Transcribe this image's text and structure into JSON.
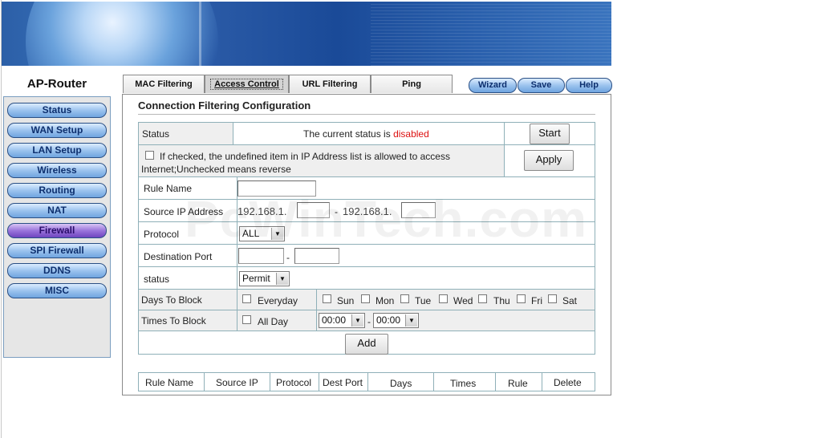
{
  "brand": "AP-Router",
  "nav": [
    {
      "label": "Status"
    },
    {
      "label": "WAN Setup"
    },
    {
      "label": "LAN Setup"
    },
    {
      "label": "Wireless"
    },
    {
      "label": "Routing"
    },
    {
      "label": "NAT"
    },
    {
      "label": "Firewall",
      "active": true
    },
    {
      "label": "SPI Firewall"
    },
    {
      "label": "DDNS"
    },
    {
      "label": "MISC"
    }
  ],
  "tabs": [
    "MAC Filtering",
    "Access Control",
    "URL Filtering",
    "Ping"
  ],
  "top_buttons": {
    "wizard": "Wizard",
    "save": "Save",
    "help": "Help"
  },
  "panel": {
    "title": "Connection Filtering Configuration",
    "status_label": "Status",
    "status_text": "The current status is",
    "status_value": "disabled",
    "start_button": "Start",
    "checkbox_text": "If checked, the undefined item in IP Address list is allowed to access Internet;Unchecked means reverse",
    "apply_button": "Apply",
    "rule_name_label": "Rule Name",
    "rule_name_value": "",
    "source_ip_label": "Source IP Address",
    "source_ip_prefix_start": "192.168.1.",
    "source_ip_start_value": "",
    "source_ip_sep": "-",
    "source_ip_prefix_end": "192.168.1.",
    "source_ip_end_value": "",
    "protocol_label": "Protocol",
    "protocol_value": "ALL",
    "dest_port_label": "Destination Port",
    "dest_port_sep": "-",
    "status_select_label": "status",
    "status_select_value": "Permit",
    "days_label": "Days To Block",
    "everyday": "Everyday",
    "days": [
      "Sun",
      "Mon",
      "Tue",
      "Wed",
      "Thu",
      "Fri",
      "Sat"
    ],
    "times_label": "Times To Block",
    "allday": "All Day",
    "time_start": "00:00",
    "time_sep": "-",
    "time_end": "00:00",
    "add_button": "Add",
    "table_headers": [
      "Rule Name",
      "Source IP",
      "Protocol",
      "Dest Port",
      "Days",
      "Times",
      "Rule",
      "Delete"
    ]
  },
  "watermark": "PcWinTech.com",
  "colors": {
    "accent": "#6fa4df",
    "active_nav": "#9a74db",
    "status_disabled": "#dd1111"
  }
}
